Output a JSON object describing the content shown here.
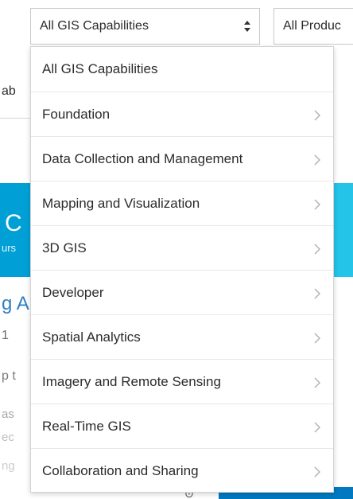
{
  "filters": {
    "capabilities_selected": "All GIS Capabilities",
    "products_selected": "All Produc"
  },
  "background": {
    "tab_fragment": "ab",
    "hero_letter": "C",
    "hero_sub": "urs",
    "link_fragment": "g A",
    "line_1": "1",
    "line_2": "p t",
    "line_3": "as",
    "line_4": "ec",
    "line_5": "ng",
    "bottom_glyph": "⊙"
  },
  "dropdown": {
    "items": [
      {
        "label": "All GIS Capabilities",
        "has_submenu": false
      },
      {
        "label": "Foundation",
        "has_submenu": true
      },
      {
        "label": "Data Collection and Management",
        "has_submenu": true
      },
      {
        "label": "Mapping and Visualization",
        "has_submenu": true
      },
      {
        "label": "3D GIS",
        "has_submenu": true
      },
      {
        "label": "Developer",
        "has_submenu": true
      },
      {
        "label": "Spatial Analytics",
        "has_submenu": true
      },
      {
        "label": "Imagery and Remote Sensing",
        "has_submenu": true
      },
      {
        "label": "Real-Time GIS",
        "has_submenu": true
      },
      {
        "label": "Collaboration and Sharing",
        "has_submenu": true
      }
    ]
  },
  "colors": {
    "hero_blue": "#00a0d6",
    "hero_cyan": "#23c4e8",
    "link_blue": "#2f80c4",
    "brand_blue": "#0079c1",
    "chevron_gray": "#b3b3b3"
  },
  "icons": {
    "select_arrows": "up-down-caret-icon",
    "submenu": "chevron-right-icon"
  }
}
